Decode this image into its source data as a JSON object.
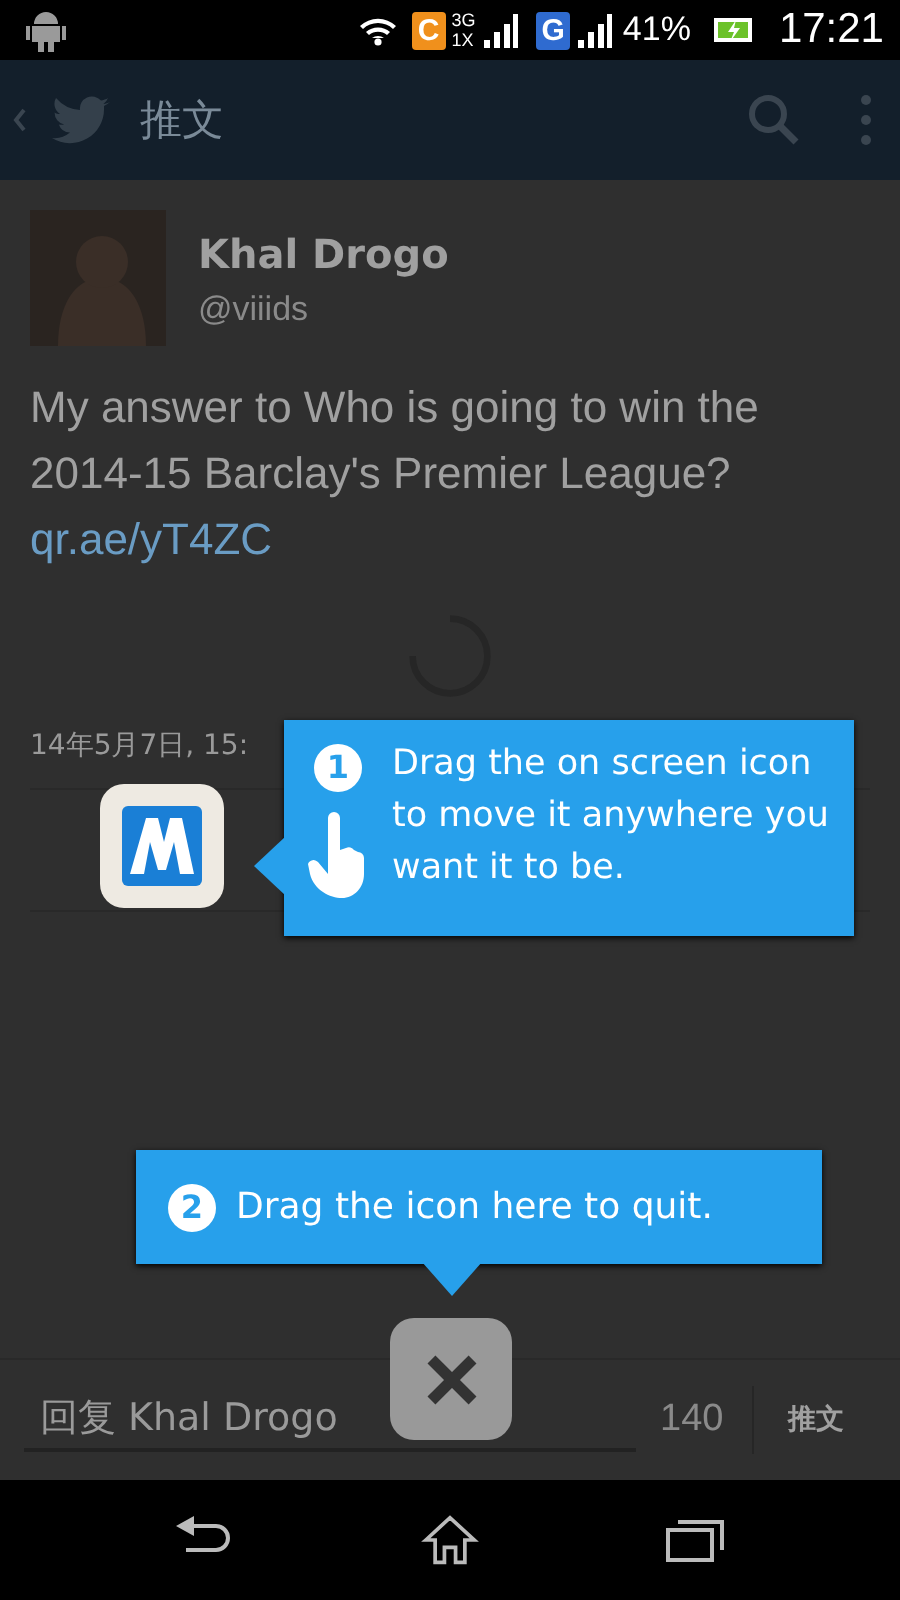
{
  "status_bar": {
    "network_badges": [
      {
        "letter": "C",
        "color": "#f0901c",
        "labels": [
          "3G",
          "1X"
        ]
      },
      {
        "letter": "G",
        "color": "#2f6bd0"
      }
    ],
    "battery": "41%",
    "time": "17:21"
  },
  "app_bar": {
    "title": "推文"
  },
  "tweet": {
    "name": "Khal Drogo",
    "handle": "@viiids",
    "text": "My answer to Who is going to win the 2014-15 Barclay's Premier League?",
    "link": "qr.ae/yT4ZC",
    "date": "14年5月7日, 15:"
  },
  "reply_bar": {
    "placeholder": "回复 Khal Drogo",
    "count": "140",
    "send": "推文"
  },
  "tips": [
    {
      "number": "1",
      "text": "Drag the on screen icon to move it anywhere you want it to be."
    },
    {
      "number": "2",
      "text": "Drag the icon here to quit."
    }
  ]
}
